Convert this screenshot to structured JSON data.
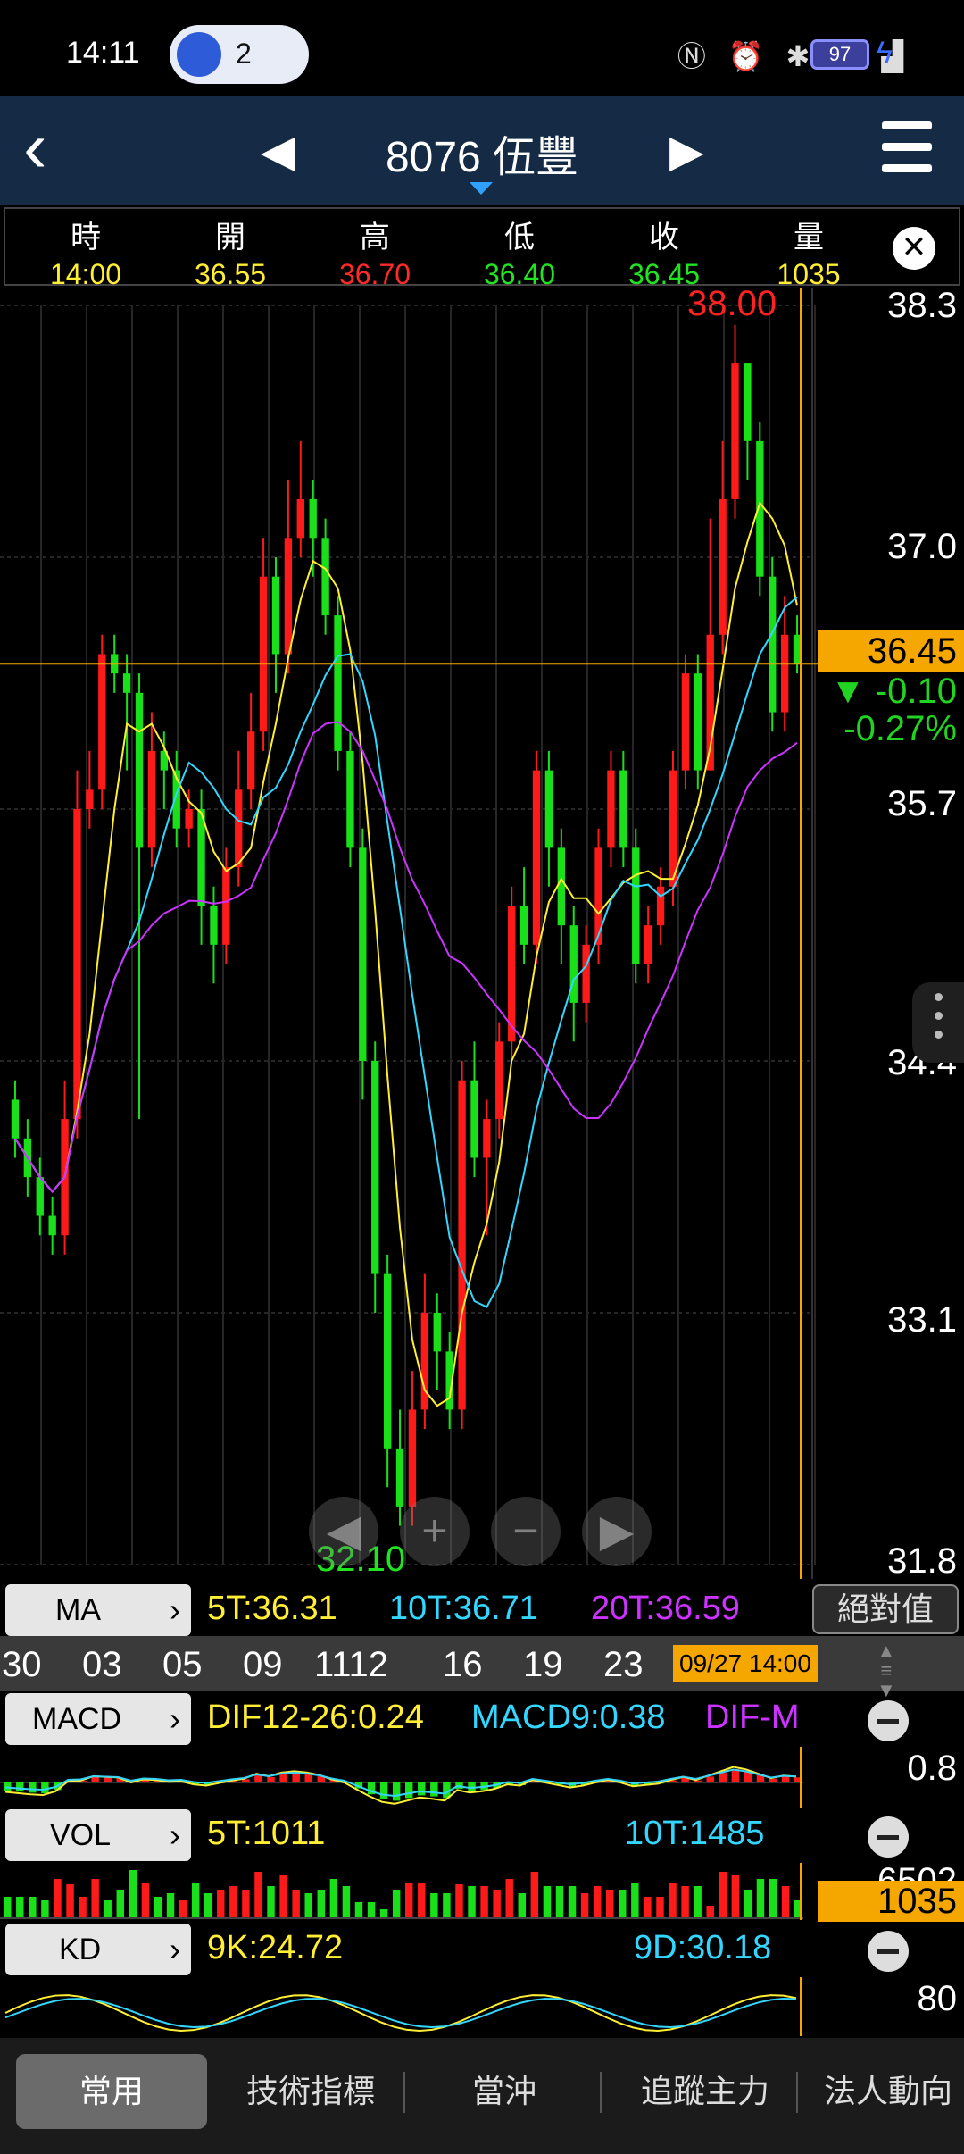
{
  "status": {
    "time": "14:11",
    "notif_count": "2",
    "battery": "97"
  },
  "header": {
    "title": "8076 伍豐"
  },
  "quote": {
    "labels": {
      "time": "時",
      "open": "開",
      "high": "高",
      "low": "低",
      "close": "收",
      "volume": "量"
    },
    "values": {
      "time": "14:00",
      "open": "36.55",
      "high": "36.70",
      "low": "36.40",
      "close": "36.45",
      "volume": "1035"
    }
  },
  "colors": {
    "up": "#ff1a1a",
    "down": "#19e019",
    "ma5": "#ffee33",
    "ma10": "#33d6ff",
    "ma20": "#cc33ff",
    "accent": "#f5a700",
    "header_bg": "#152b45"
  },
  "price_axis": {
    "ticks": [
      "38.3",
      "37.0",
      "35.7",
      "34.4",
      "33.1",
      "31.8"
    ]
  },
  "current": {
    "price": "36.45",
    "change": "▼ -0.10",
    "change_pct": "-0.27%"
  },
  "markers": {
    "high": "38.00",
    "low": "32.10"
  },
  "ma_bar": {
    "button": "MA",
    "ma5": "5T:36.31",
    "ma10": "10T:36.71",
    "ma20": "20T:36.59",
    "toggle": "絕對值"
  },
  "date_axis": {
    "labels": [
      "30",
      "03",
      "05",
      "09",
      "1112",
      "16",
      "19",
      "23"
    ],
    "selected": "09/27 14:00"
  },
  "macd_bar": {
    "button": "MACD",
    "dif": "DIF12-26:0.24",
    "macd": "MACD9:0.38",
    "osc": "DIF-M",
    "axis_value": "0.8"
  },
  "vol_bar": {
    "button": "VOL",
    "ma5": "5T:1011",
    "ma10": "10T:1485",
    "axis_top": "6502",
    "current": "1035"
  },
  "kd_bar": {
    "button": "KD",
    "k": "9K:24.72",
    "d": "9D:30.18",
    "axis_value": "80"
  },
  "tabs": [
    "常用",
    "技術指標",
    "當沖",
    "追蹤主力",
    "法人動向"
  ],
  "chart_data": {
    "type": "candlestick",
    "y_axis_ticks": [
      38.3,
      37.0,
      35.7,
      34.4,
      33.1,
      31.8
    ],
    "ylim": [
      31.8,
      38.3
    ],
    "last_close": 36.45,
    "period_high": 38.0,
    "period_low": 32.1,
    "candles": [
      [
        34.2,
        34.0,
        34.3,
        33.9
      ],
      [
        34.0,
        33.8,
        34.1,
        33.7
      ],
      [
        33.8,
        33.6,
        33.9,
        33.5
      ],
      [
        33.6,
        33.5,
        33.7,
        33.4
      ],
      [
        33.5,
        34.1,
        34.3,
        33.4
      ],
      [
        34.1,
        35.7,
        35.9,
        34.0
      ],
      [
        35.7,
        35.8,
        36.0,
        35.6
      ],
      [
        35.8,
        36.5,
        36.6,
        35.7
      ],
      [
        36.5,
        36.4,
        36.6,
        36.3
      ],
      [
        36.4,
        36.3,
        36.5,
        35.9
      ],
      [
        36.3,
        35.5,
        36.4,
        34.1
      ],
      [
        35.5,
        36.0,
        36.2,
        35.4
      ],
      [
        36.0,
        35.9,
        36.1,
        35.7
      ],
      [
        35.9,
        35.6,
        36.0,
        35.5
      ],
      [
        35.6,
        35.7,
        35.8,
        35.5
      ],
      [
        35.7,
        35.2,
        35.8,
        35.0
      ],
      [
        35.2,
        35.0,
        35.3,
        34.8
      ],
      [
        35.0,
        35.4,
        35.5,
        34.9
      ],
      [
        35.4,
        35.8,
        36.0,
        35.3
      ],
      [
        35.8,
        36.1,
        36.3,
        35.7
      ],
      [
        36.1,
        36.9,
        37.1,
        36.0
      ],
      [
        36.9,
        36.5,
        37.0,
        36.3
      ],
      [
        36.5,
        37.1,
        37.4,
        36.4
      ],
      [
        37.1,
        37.3,
        37.6,
        37.0
      ],
      [
        37.3,
        37.1,
        37.4,
        36.9
      ],
      [
        37.1,
        36.7,
        37.2,
        36.6
      ],
      [
        36.7,
        36.0,
        36.8,
        35.9
      ],
      [
        36.0,
        35.5,
        36.1,
        35.4
      ],
      [
        35.5,
        34.4,
        35.6,
        34.2
      ],
      [
        34.4,
        33.3,
        34.5,
        33.1
      ],
      [
        33.3,
        32.4,
        33.4,
        32.2
      ],
      [
        32.4,
        32.1,
        32.6,
        32.0
      ],
      [
        32.1,
        32.6,
        32.8,
        32.0
      ],
      [
        32.6,
        33.1,
        33.3,
        32.5
      ],
      [
        33.1,
        32.9,
        33.2,
        32.7
      ],
      [
        32.9,
        32.6,
        33.0,
        32.5
      ],
      [
        32.6,
        34.3,
        34.4,
        32.5
      ],
      [
        34.3,
        33.9,
        34.5,
        33.8
      ],
      [
        33.9,
        34.1,
        34.2,
        33.5
      ],
      [
        34.1,
        34.5,
        34.6,
        34.0
      ],
      [
        34.5,
        35.2,
        35.3,
        34.4
      ],
      [
        35.2,
        35.0,
        35.4,
        34.9
      ],
      [
        35.0,
        35.9,
        36.0,
        34.9
      ],
      [
        35.9,
        35.5,
        36.0,
        35.3
      ],
      [
        35.5,
        35.1,
        35.6,
        34.9
      ],
      [
        35.1,
        34.7,
        35.2,
        34.5
      ],
      [
        34.7,
        35.0,
        35.1,
        34.6
      ],
      [
        35.0,
        35.5,
        35.6,
        34.9
      ],
      [
        35.5,
        35.9,
        36.0,
        35.4
      ],
      [
        35.9,
        35.5,
        36.0,
        35.4
      ],
      [
        35.5,
        34.9,
        35.6,
        34.8
      ],
      [
        34.9,
        35.1,
        35.2,
        34.8
      ],
      [
        35.1,
        35.3,
        35.4,
        35.0
      ],
      [
        35.3,
        35.9,
        36.0,
        35.2
      ],
      [
        35.9,
        36.4,
        36.5,
        35.8
      ],
      [
        36.4,
        35.9,
        36.5,
        35.8
      ],
      [
        35.9,
        36.6,
        37.2,
        35.9
      ],
      [
        36.6,
        37.3,
        37.6,
        36.5
      ],
      [
        37.3,
        38.0,
        38.2,
        37.2
      ],
      [
        38.0,
        37.6,
        38.0,
        37.4
      ],
      [
        37.6,
        36.9,
        37.7,
        36.8
      ],
      [
        36.9,
        36.2,
        37.0,
        36.1
      ],
      [
        36.2,
        36.6,
        36.8,
        36.1
      ],
      [
        36.6,
        36.45,
        36.7,
        36.4
      ]
    ]
  }
}
